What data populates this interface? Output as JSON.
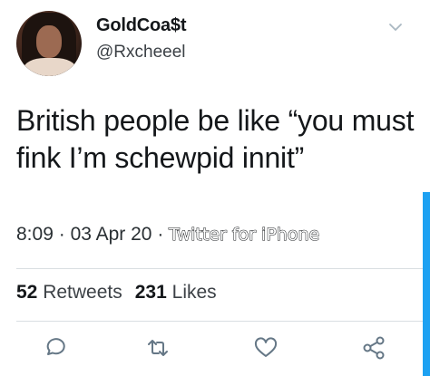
{
  "user": {
    "display_name": "GoldCoa$t",
    "handle": "@Rxcheeel"
  },
  "tweet": {
    "text": "British people be like “you must fink I’m schewpid innit”",
    "time": "8:09",
    "date": "03 Apr 20",
    "separator": "·",
    "source": "Twitter for iPhone"
  },
  "stats": {
    "retweets_count": "52",
    "retweets_label": "Retweets",
    "likes_count": "231",
    "likes_label": "Likes"
  },
  "icons": [
    "chevron-down-icon",
    "reply-icon",
    "retweet-icon",
    "like-icon",
    "share-icon"
  ],
  "colors": {
    "accent": "#1da1f2",
    "icon": "#657786"
  }
}
